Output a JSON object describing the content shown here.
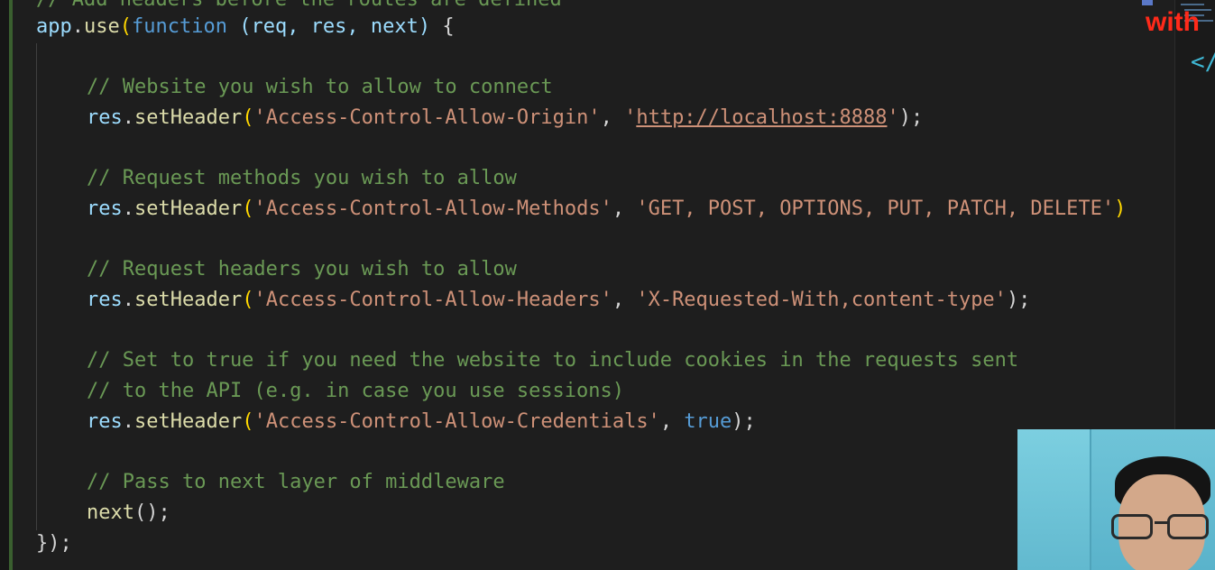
{
  "editor": {
    "top_partial_comment": "// Add headers before the routes are defined",
    "lines": {
      "l1": {
        "obj": "app",
        "dot": ".",
        "fn": "use",
        "open": "(",
        "kw": "function",
        "params": " (req, res, next) ",
        "brace": "{"
      },
      "l3": {
        "comment": "// Website you wish to allow to connect"
      },
      "l4": {
        "obj": "res",
        "dot": ".",
        "fn": "setHeader",
        "open": "(",
        "arg1": "'Access-Control-Allow-Origin'",
        "sep": ", ",
        "arg2_q1": "'",
        "arg2_link": "http://localhost:8888",
        "arg2_q2": "'",
        "close": ");"
      },
      "l6": {
        "comment": "// Request methods you wish to allow"
      },
      "l7": {
        "obj": "res",
        "dot": ".",
        "fn": "setHeader",
        "open": "(",
        "arg1": "'Access-Control-Allow-Methods'",
        "sep": ", ",
        "arg2": "'GET, POST, OPTIONS, PUT, PATCH, DELETE'",
        "close": ")"
      },
      "l9": {
        "comment": "// Request headers you wish to allow"
      },
      "l10": {
        "obj": "res",
        "dot": ".",
        "fn": "setHeader",
        "open": "(",
        "arg1": "'Access-Control-Allow-Headers'",
        "sep": ", ",
        "arg2": "'X-Requested-With,content-type'",
        "close": ");"
      },
      "l12": {
        "comment": "// Set to true if you need the website to include cookies in the requests sent"
      },
      "l13": {
        "comment": "// to the API (e.g. in case you use sessions)"
      },
      "l14": {
        "obj": "res",
        "dot": ".",
        "fn": "setHeader",
        "open": "(",
        "arg1": "'Access-Control-Allow-Credentials'",
        "sep": ", ",
        "kw": "true",
        "close": ");"
      },
      "l16": {
        "comment": "// Pass to next layer of middleware"
      },
      "l17": {
        "fn": "next",
        "call": "();"
      },
      "l18": {
        "close": "});"
      }
    }
  },
  "overlay": {
    "with_text": "with",
    "close_tag": "</"
  },
  "colors": {
    "background": "#1e1e1e",
    "comment": "#6a9955",
    "string": "#ce9178",
    "variable": "#9cdcfe",
    "function": "#dcdcaa",
    "keyword": "#569cd6",
    "overlay_red": "#ff2a1a"
  }
}
